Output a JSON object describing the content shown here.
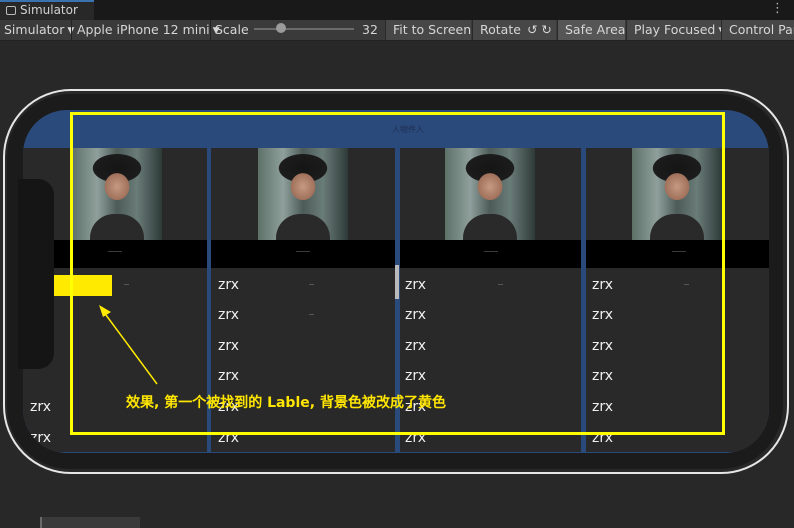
{
  "window": {
    "tab_title": "Simulator",
    "menu_glyph": "⋮"
  },
  "toolbar": {
    "mode": "Simulator",
    "device": "Apple iPhone 12 mini",
    "scale_label": "Scale",
    "scale_value": "32",
    "fit_to_screen": "Fit to Screen",
    "rotate": "Rotate",
    "rotate_ccw_glyph": "↺",
    "rotate_cw_glyph": "↻",
    "safe_area": "Safe Area",
    "play_focused": "Play Focused",
    "control_panel": "Control Pan"
  },
  "game": {
    "header_text": "人物件入",
    "cell_text": "zrx",
    "columns": [
      {
        "rows": [
          "",
          "",
          "",
          "",
          "zrx",
          "zrx"
        ]
      },
      {
        "rows": [
          "zrx",
          "zrx",
          "zrx",
          "zrx",
          "zrx",
          "zrx"
        ]
      },
      {
        "rows": [
          "zrx",
          "zrx",
          "zrx",
          "zrx",
          "zrx",
          "zrx"
        ]
      },
      {
        "rows": [
          "zrx",
          "zrx",
          "zrx",
          "zrx",
          "zrx",
          "zrx"
        ]
      }
    ]
  },
  "annotation": {
    "text": "效果, 第一个被找到的 Lable, 背景色被改成了黄色"
  },
  "colors": {
    "highlight": "#ffff00",
    "label_background": "#ffea00",
    "screen_blue": "#2b4a7c"
  }
}
